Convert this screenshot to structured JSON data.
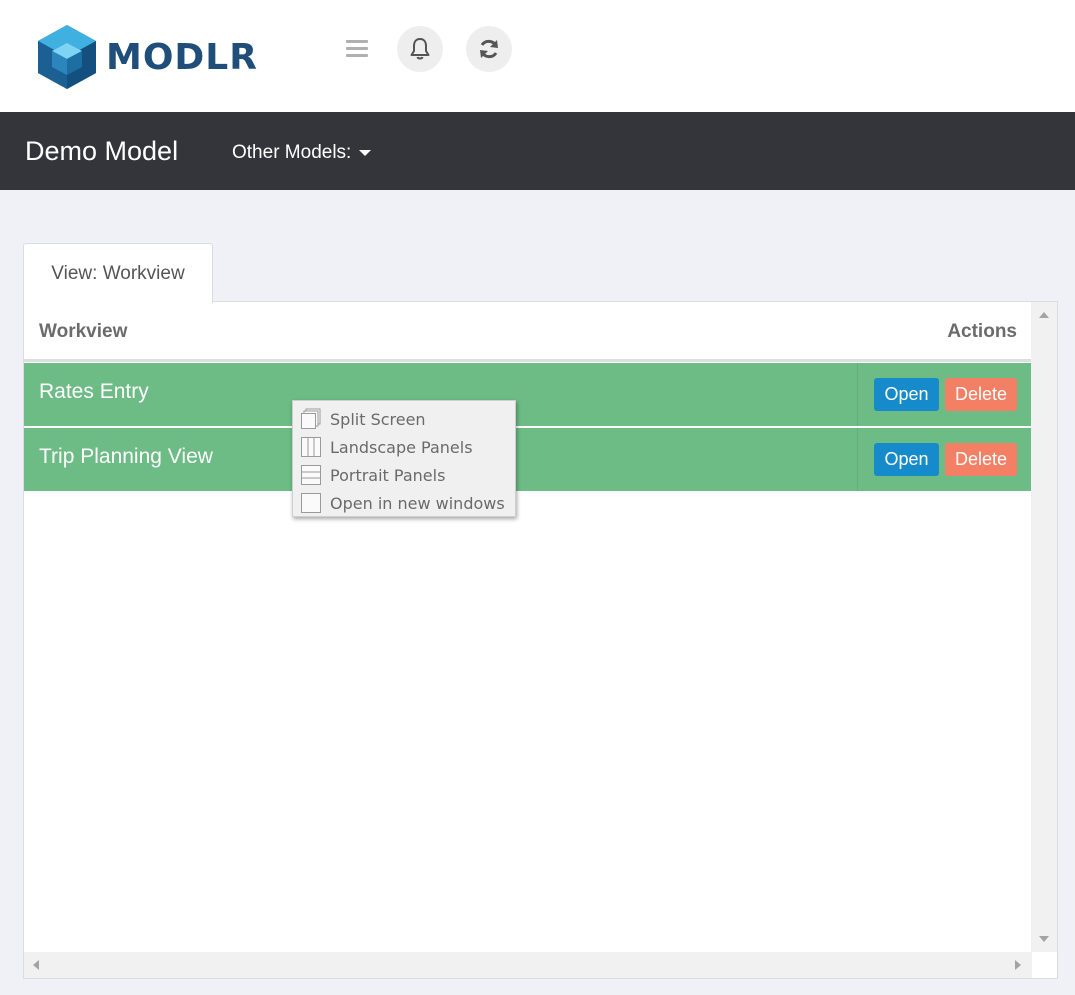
{
  "header": {
    "logo_text": "MODLR",
    "brand_color": "#1e4e79",
    "icons": [
      "hamburger-icon",
      "bell-icon",
      "refresh-icon"
    ]
  },
  "navbar": {
    "model_title": "Demo Model",
    "other_models_label": "Other Models:"
  },
  "tab": {
    "label": "View: Workview"
  },
  "table": {
    "columns": [
      "Workview",
      "Actions"
    ],
    "rows": [
      {
        "name": "Rates Entry",
        "open_label": "Open",
        "delete_label": "Delete"
      },
      {
        "name": "Trip Planning View",
        "open_label": "Open",
        "delete_label": "Delete"
      }
    ],
    "row_color": "#6dbb85",
    "open_color": "#168bcc",
    "delete_color": "#f37f64"
  },
  "context_menu": {
    "items": [
      {
        "label": "Split Screen",
        "icon": "split-screen-icon"
      },
      {
        "label": "Landscape Panels",
        "icon": "landscape-panels-icon"
      },
      {
        "label": "Portrait Panels",
        "icon": "portrait-panels-icon"
      },
      {
        "label": "Open in new windows",
        "icon": "new-window-icon"
      }
    ]
  }
}
